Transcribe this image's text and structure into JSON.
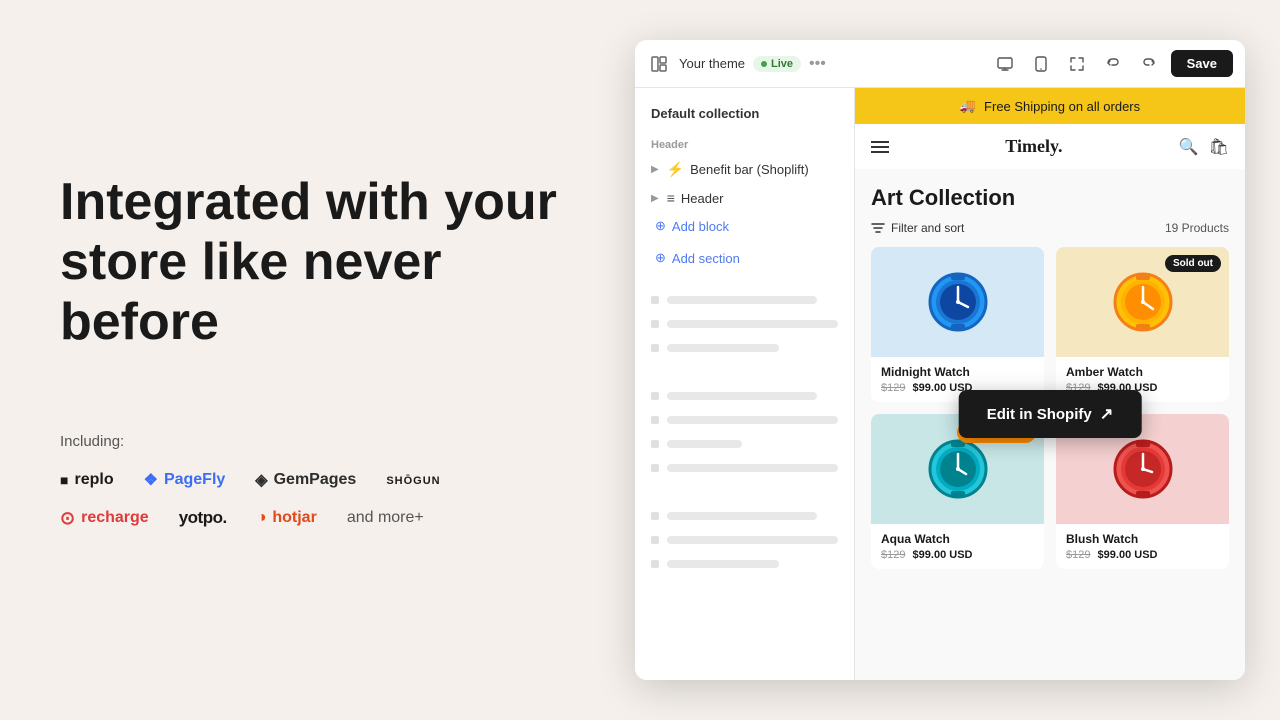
{
  "left": {
    "hero_title": "Integrated with your store like never before",
    "including_label": "Including:",
    "logos_row1": [
      {
        "id": "replo",
        "prefix": "■",
        "name": "replo",
        "color": "#1a1a1a"
      },
      {
        "id": "pagefly",
        "prefix": "❖",
        "name": "PageFly",
        "color": "#3b6ef5"
      },
      {
        "id": "gempages",
        "prefix": "◈",
        "name": "GemPages",
        "color": "#2d2d2d"
      },
      {
        "id": "shogun",
        "prefix": "",
        "name": "shōgun",
        "color": "#1a1a1a"
      }
    ],
    "logos_row2": [
      {
        "id": "recharge",
        "prefix": "⊙",
        "name": "recharge",
        "color": "#e03a3a"
      },
      {
        "id": "yotpo",
        "prefix": "",
        "name": "yotpo.",
        "color": "#1a1a1a"
      },
      {
        "id": "hotjar",
        "prefix": "◑",
        "name": "hotjar",
        "color": "#e04b1a"
      },
      {
        "id": "andmore",
        "prefix": "",
        "name": "and more+",
        "color": "#555"
      }
    ]
  },
  "editor": {
    "topbar": {
      "theme_label": "Your theme",
      "live_badge": "Live",
      "dots": "•••",
      "save_button": "Save"
    },
    "sidebar": {
      "collection_title": "Default collection",
      "header_label": "Header",
      "items": [
        {
          "label": "Benefit bar (Shoplift)",
          "icon": "⚡"
        },
        {
          "label": "Header",
          "icon": "≡"
        }
      ],
      "add_block": "Add block",
      "add_section": "Add section"
    },
    "store": {
      "banner_icon": "🚚",
      "banner_text": "Free Shipping on all orders",
      "logo": "Timely.",
      "collection_title": "Art Collection",
      "filter_label": "Filter and sort",
      "products_count": "19 Products",
      "products": [
        {
          "name": "Midnight Watch",
          "original_price": "$129",
          "sale_price": "$99.00 USD",
          "badge": "",
          "bg": "blue-bg",
          "emoji": "⌚"
        },
        {
          "name": "Amber Watch",
          "original_price": "$129",
          "sale_price": "$99.00 USD",
          "badge": "sold_out",
          "bg": "yellow-bg",
          "emoji": "⌚"
        },
        {
          "name": "Aqua Watch",
          "original_price": "$129",
          "sale_price": "$99.00 USD",
          "badge": "low_stock",
          "bg": "teal-bg",
          "emoji": "⌚"
        },
        {
          "name": "Blush Watch",
          "original_price": "$129",
          "sale_price": "$99.00 USD",
          "badge": "",
          "bg": "pink-bg",
          "emoji": "⌚"
        }
      ],
      "sold_out_label": "Sold out",
      "low_stock_label": "Low stock"
    },
    "edit_button": "Edit in Shopify"
  }
}
